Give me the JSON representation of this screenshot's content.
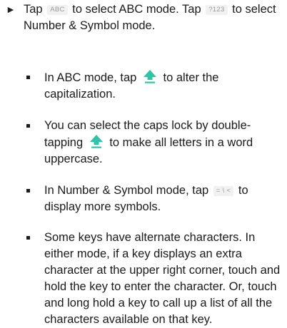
{
  "main": {
    "arrow": "►",
    "t1": "Tap",
    "key_abc": "ABC",
    "t2": "to select ABC mode. Tap",
    "key_123": "?123",
    "t3": "to select Number & Symbol mode."
  },
  "bullets": [
    {
      "a": "In ABC mode, tap",
      "b": "to alter the capitalization."
    },
    {
      "a": "You can select the caps lock by double-tapping",
      "b": "to make all letters in a word uppercase."
    },
    {
      "a": "In Number & Symbol mode, tap",
      "key": "= \\ <",
      "b": "to display more symbols."
    },
    {
      "a": "Some keys have alternate characters. In either mode, if a key displays an extra character at the upper right corner, touch and hold the key to enter the character. Or, touch and long hold a key to call up a list of all the characters available on that key."
    }
  ],
  "icons": {
    "shift": "shift-key-arrow-up",
    "accent": "#2ec4a6"
  }
}
